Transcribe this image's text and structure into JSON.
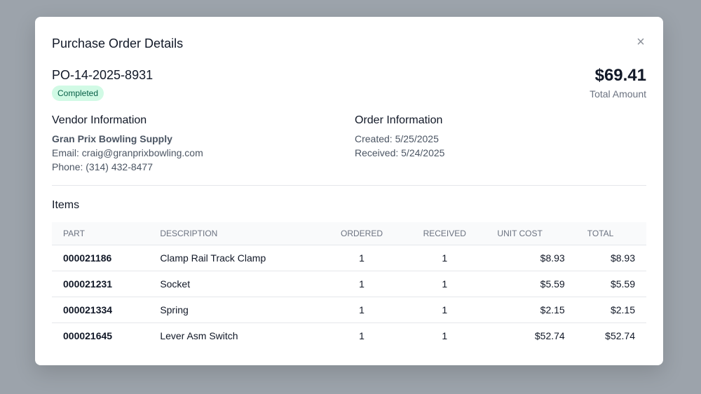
{
  "modal": {
    "title": "Purchase Order Details",
    "close_symbol": "×"
  },
  "order": {
    "po_number": "PO-14-2025-8931",
    "status": "Completed",
    "total_amount": "$69.41",
    "total_label": "Total Amount"
  },
  "vendor": {
    "heading": "Vendor Information",
    "name": "Gran Prix Bowling Supply",
    "email": "Email: craig@granprixbowling.com",
    "phone": "Phone: (314) 432-8477"
  },
  "order_info": {
    "heading": "Order Information",
    "created": "Created: 5/25/2025",
    "received": "Received: 5/24/2025"
  },
  "items": {
    "heading": "Items",
    "columns": [
      "Part",
      "Description",
      "Ordered",
      "Received",
      "Unit Cost",
      "Total"
    ],
    "rows": [
      {
        "part": "000021186",
        "description": "Clamp Rail Track Clamp",
        "ordered": "1",
        "received": "1",
        "unit_cost": "$8.93",
        "total": "$8.93"
      },
      {
        "part": "000021231",
        "description": "Socket",
        "ordered": "1",
        "received": "1",
        "unit_cost": "$5.59",
        "total": "$5.59"
      },
      {
        "part": "000021334",
        "description": "Spring",
        "ordered": "1",
        "received": "1",
        "unit_cost": "$2.15",
        "total": "$2.15"
      },
      {
        "part": "000021645",
        "description": "Lever Asm Switch",
        "ordered": "1",
        "received": "1",
        "unit_cost": "$52.74",
        "total": "$52.74"
      }
    ]
  },
  "colors": {
    "backdrop": "#9ca3ab",
    "badge_bg": "#d1fae5",
    "badge_text": "#065f46"
  },
  "icons": {
    "close": "close-icon"
  }
}
